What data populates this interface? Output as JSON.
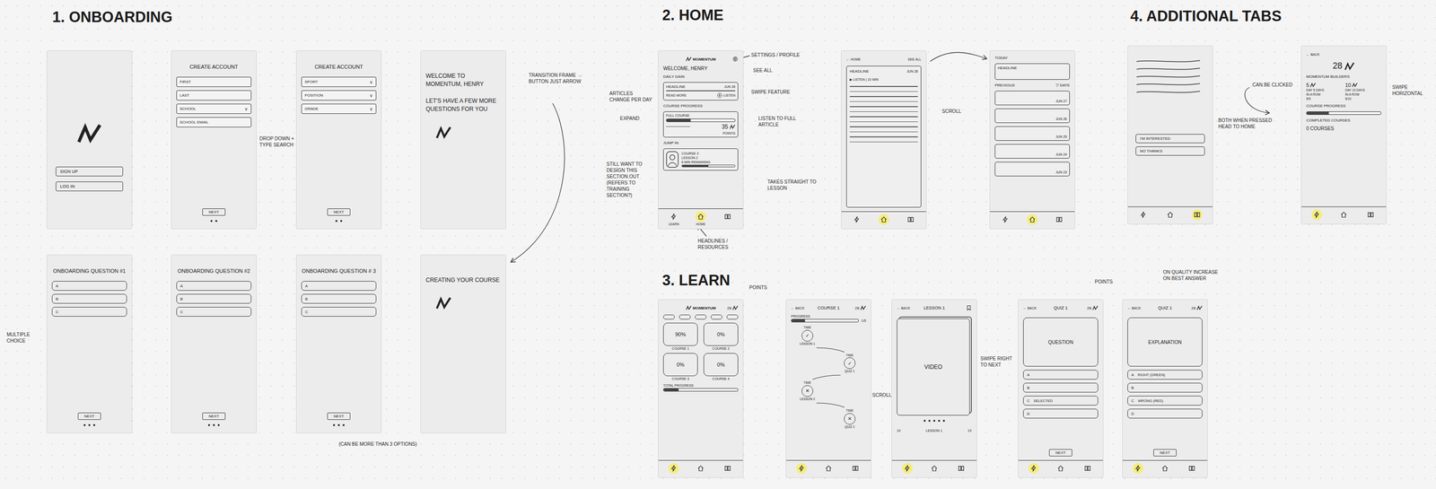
{
  "sections": [
    {
      "title": "1. ONBOARDING",
      "screens": [
        {
          "items": [
            {
              "kind": "logo"
            },
            {
              "kind": "button",
              "text": "SIGN UP"
            },
            {
              "kind": "button",
              "text": "LOG IN"
            }
          ]
        },
        {
          "items": [
            {
              "kind": "title",
              "text": "CREATE ACCOUNT"
            },
            {
              "kind": "field",
              "text": "FIRST"
            },
            {
              "kind": "field",
              "text": "LAST"
            },
            {
              "kind": "field",
              "text": "SCHOOL",
              "icon": "∨"
            },
            {
              "kind": "field",
              "text": "SCHOOL EMAIL"
            },
            {
              "kind": "next",
              "text": "NEXT"
            },
            {
              "kind": "pager",
              "pages": 2
            }
          ]
        },
        {
          "items": [
            {
              "kind": "title",
              "text": "CREATE ACCOUNT"
            },
            {
              "kind": "field",
              "text": "SPORT",
              "icon": "∨"
            },
            {
              "kind": "field",
              "text": "POSITION",
              "icon": "∨"
            },
            {
              "kind": "field",
              "text": "GRADE",
              "icon": "∨"
            },
            {
              "kind": "next",
              "text": "NEXT"
            },
            {
              "kind": "pager",
              "pages": 2
            }
          ]
        },
        {
          "items": [
            {
              "kind": "heading",
              "text": "WELCOME TO MOMENTUM, HENRY"
            },
            {
              "kind": "heading",
              "text": "LET'S HAVE A FEW MORE QUESTIONS FOR YOU"
            },
            {
              "kind": "mark"
            }
          ]
        },
        {
          "items": [
            {
              "kind": "title",
              "text": "ONBOARDING QUESTION #1"
            },
            {
              "kind": "option",
              "letter": "A"
            },
            {
              "kind": "option",
              "letter": "B"
            },
            {
              "kind": "option",
              "letter": "C"
            },
            {
              "kind": "next",
              "text": "NEXT"
            },
            {
              "kind": "pager",
              "pages": 3
            }
          ]
        },
        {
          "items": [
            {
              "kind": "title",
              "text": "ONBOARDING QUESTION #2"
            },
            {
              "kind": "option",
              "letter": "A"
            },
            {
              "kind": "option",
              "letter": "B"
            },
            {
              "kind": "option",
              "letter": "C"
            },
            {
              "kind": "next",
              "text": "NEXT"
            },
            {
              "kind": "pager",
              "pages": 3
            }
          ]
        },
        {
          "items": [
            {
              "kind": "title",
              "text": "ONBOARDING QUESTION # 3"
            },
            {
              "kind": "option",
              "letter": "A"
            },
            {
              "kind": "option",
              "letter": "B"
            },
            {
              "kind": "option",
              "letter": "C"
            },
            {
              "kind": "next",
              "text": "NEXT"
            },
            {
              "kind": "pager",
              "pages": 3
            }
          ]
        },
        {
          "items": [
            {
              "kind": "heading",
              "text": "CREATING YOUR COURSE"
            },
            {
              "kind": "mark"
            }
          ]
        }
      ]
    },
    {
      "title": "2. HOME",
      "screens": [
        {
          "items": [
            {
              "kind": "brandbar",
              "brand": "MOMENTUM"
            },
            {
              "kind": "text",
              "text": "WELCOME, HENRY"
            },
            {
              "kind": "label",
              "text": "DAILY GAIN"
            },
            {
              "kind": "headline-card",
              "title": "HEADLINE",
              "date": "JUN 28",
              "more": "READ MORE",
              "listen": "LISTEN"
            },
            {
              "kind": "label",
              "text": "COURSE PROGRESS"
            },
            {
              "kind": "progress-card",
              "label": "FULL COURSE",
              "level": 0.35,
              "points": "35",
              "unit": "POINTS"
            },
            {
              "kind": "label",
              "text": "JUMP IN"
            },
            {
              "kind": "lesson-card",
              "lines": [
                "COURSE 2",
                "LESSON 2",
                "6 MIN REMAINING"
              ],
              "level": 0.5
            }
          ],
          "tabs": [
            {
              "label": "LEARN",
              "selected": false
            },
            {
              "label": "HOME",
              "selected": true
            },
            {
              "selected": false
            }
          ]
        },
        {
          "items": [
            {
              "kind": "navbar",
              "back": "← HOME",
              "right": "SEE ALL",
              "right_kind": "text"
            },
            {
              "kind": "article",
              "title": "HEADLINE",
              "date": "JUN 28",
              "meta": "▶ LISTEN | 10 MIN",
              "lines": 12
            }
          ],
          "tabs": [
            {
              "selected": false
            },
            {
              "selected": true
            },
            {
              "selected": false
            }
          ]
        },
        {
          "items": [
            {
              "kind": "label",
              "text": "TODAY"
            },
            {
              "kind": "list-card",
              "title": "HEADLINE"
            },
            {
              "kind": "section-row",
              "left": "PREVIOUS",
              "right": "▽ DATE"
            },
            {
              "kind": "dated-card",
              "date": "JUN 27"
            },
            {
              "kind": "dated-card",
              "date": "JUN 26"
            },
            {
              "kind": "dated-card",
              "date": "JUN 25"
            },
            {
              "kind": "dated-card",
              "date": "JUN 24"
            },
            {
              "kind": "dated-card",
              "date": "JUN 23"
            }
          ],
          "tabs": [
            {
              "selected": false
            },
            {
              "selected": true
            },
            {
              "selected": false
            }
          ]
        }
      ]
    },
    {
      "title": "3. LEARN",
      "screens": [
        {
          "items": [
            {
              "kind": "brandbar",
              "brand": "MOMENTUM",
              "points": "28"
            },
            {
              "kind": "chips",
              "count": 5
            },
            {
              "kind": "course-grid",
              "courses": [
                {
                  "percent": "90%",
                  "name": "COURSE 1"
                },
                {
                  "percent": "0%",
                  "name": "COURSE 2"
                },
                {
                  "percent": "0%",
                  "name": "COURSE 3"
                },
                {
                  "percent": "0%",
                  "name": "COURSE 4"
                }
              ]
            },
            {
              "kind": "bar",
              "label": "TOTAL PROGRESS",
              "level": 0.2
            }
          ],
          "tabs": [
            {
              "selected": true
            },
            {
              "selected": false
            },
            {
              "selected": false
            }
          ]
        },
        {
          "items": [
            {
              "kind": "navbar",
              "back": "← BACK",
              "title": "COURSE 1",
              "right": "28",
              "right_kind": "points"
            },
            {
              "kind": "bar",
              "label": "PROGRESS",
              "level": 0.2,
              "reading": "1/5"
            },
            {
              "kind": "path",
              "nodes": [
                {
                  "time": "TIME",
                  "mark": "✓",
                  "label": "LESSON 1"
                },
                {
                  "time": "TIME",
                  "mark": "✓",
                  "label": "QUIZ 1"
                },
                {
                  "time": "TIME",
                  "mark": "✕",
                  "label": "LESSON 2"
                },
                {
                  "time": "TIME",
                  "mark": "✕",
                  "label": "QUIZ 2"
                }
              ]
            }
          ],
          "tabs": [
            {
              "selected": true
            },
            {
              "selected": false
            },
            {
              "selected": false
            }
          ]
        },
        {
          "items": [
            {
              "kind": "navbar",
              "back": "← BACK",
              "title": "LESSON 1",
              "right_kind": "bookmark"
            },
            {
              "kind": "video",
              "text": "VIDEO"
            },
            {
              "kind": "pager",
              "pages": 5
            },
            {
              "kind": "player",
              "left": "10",
              "center": "LESSON 1",
              "right": "1X"
            }
          ],
          "tabs": [
            {
              "selected": true
            },
            {
              "selected": false
            },
            {
              "selected": false
            }
          ]
        },
        {
          "items": [
            {
              "kind": "navbar",
              "back": "← BACK",
              "title": "QUIZ 1",
              "right": "28",
              "right_kind": "points"
            },
            {
              "kind": "box",
              "text": "QUESTION"
            },
            {
              "kind": "option",
              "letter": "A"
            },
            {
              "kind": "option",
              "letter": "B"
            },
            {
              "kind": "option",
              "letter": "C",
              "text": "SELECTED"
            },
            {
              "kind": "option",
              "letter": "D"
            },
            {
              "kind": "next",
              "text": "NEXT"
            }
          ],
          "tabs": [
            {
              "selected": true
            },
            {
              "selected": false
            },
            {
              "selected": false
            }
          ]
        },
        {
          "items": [
            {
              "kind": "navbar",
              "back": "← BACK",
              "title": "QUIZ 1",
              "right": "28",
              "right_kind": "points"
            },
            {
              "kind": "box",
              "text": "EXPLANATION"
            },
            {
              "kind": "option",
              "letter": "A",
              "text": "RIGHT (GREEN)"
            },
            {
              "kind": "option",
              "letter": "B"
            },
            {
              "kind": "option",
              "letter": "C",
              "text": "WRONG (RED)"
            },
            {
              "kind": "option",
              "letter": "D"
            },
            {
              "kind": "next",
              "text": "NEXT"
            }
          ],
          "tabs": [
            {
              "selected": true
            },
            {
              "selected": false
            },
            {
              "selected": false
            }
          ]
        }
      ]
    },
    {
      "title": "4. ADDITIONAL TABS",
      "screens": [
        {
          "items": [
            {
              "kind": "scribble",
              "lines": 5
            },
            {
              "kind": "pill",
              "text": "I'M INTERESTED"
            },
            {
              "kind": "pill",
              "text": "NO THANKS"
            }
          ],
          "tabs": [
            {
              "selected": false
            },
            {
              "selected": false
            },
            {
              "selected": true
            }
          ]
        },
        {
          "items": [
            {
              "kind": "navbar",
              "back": "← BACK"
            },
            {
              "kind": "points-big",
              "points": "28"
            },
            {
              "kind": "label",
              "text": "MOMENTUM BUILDERS"
            },
            {
              "kind": "streaks",
              "streaks": [
                {
                  "points": "5",
                  "lines": [
                    "DAY 5 DAYS",
                    "IN A ROW",
                    "5/5"
                  ]
                },
                {
                  "points": "10",
                  "lines": [
                    "DAY 10 DAYS",
                    "IN A ROW",
                    "5/10"
                  ]
                }
              ]
            },
            {
              "kind": "label",
              "text": "COURSE PROGRESS"
            },
            {
              "kind": "bar",
              "level": 0.3
            },
            {
              "kind": "label",
              "text": "COMPLETED COURSES"
            },
            {
              "kind": "text",
              "text": "0 COURSES"
            }
          ],
          "tabs": [
            {
              "selected": true
            },
            {
              "selected": false
            },
            {
              "selected": false
            }
          ]
        }
      ]
    }
  ],
  "notes": [
    {
      "text": "DROP DOWN + TYPE SEARCH"
    },
    {
      "text": "TRANSITION FRAME → BUTTON JUST ARROW"
    },
    {
      "text": "MULTIPLE CHOICE"
    },
    {
      "text": "(CAN BE MORE THAN 3 OPTIONS)"
    },
    {
      "text": "SETTINGS / PROFILE"
    },
    {
      "text": "SEE ALL"
    },
    {
      "text": "SWIPE FEATURE"
    },
    {
      "text": "LISTEN TO FULL ARTICLE"
    },
    {
      "text": "ARTICLES CHANGE PER DAY"
    },
    {
      "text": "EXPAND"
    },
    {
      "text": "STILL WANT TO DESIGN THIS SECTION OUT (REFERS TO TRAINING SECTION?)"
    },
    {
      "text": "TAKES STRAIGHT TO LESSON"
    },
    {
      "text": "HEADLINES / RESOURCES"
    },
    {
      "text": "SCROLL"
    },
    {
      "text": "POINTS"
    },
    {
      "text": "SCROLL"
    },
    {
      "text": "SWIPE RIGHT TO NEXT"
    },
    {
      "text": "POINTS"
    },
    {
      "text": "ON QUALITY INCREASE ON BEST ANSWER"
    },
    {
      "text": "CAN BE CLICKED"
    },
    {
      "text": "BOTH WHEN PRESSED HEAD TO HOME"
    },
    {
      "text": "SWIPE HORIZONTAL"
    }
  ]
}
